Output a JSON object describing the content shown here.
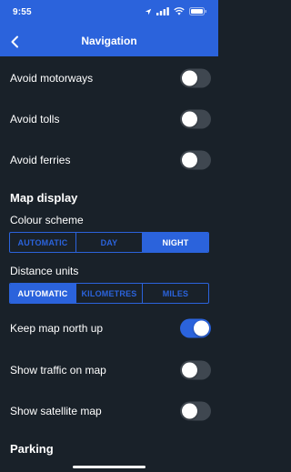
{
  "status_bar": {
    "time": "9:55",
    "location_icon": "location-arrow-icon",
    "signal_icon": "cellular-signal-icon",
    "wifi_icon": "wifi-icon",
    "battery_icon": "battery-icon"
  },
  "nav": {
    "title": "Navigation",
    "back_icon": "chevron-left-icon"
  },
  "route_options": [
    {
      "label": "Avoid motorways",
      "on": false
    },
    {
      "label": "Avoid tolls",
      "on": false
    },
    {
      "label": "Avoid ferries",
      "on": false
    }
  ],
  "map_display": {
    "title": "Map display",
    "colour_scheme": {
      "label": "Colour scheme",
      "options": [
        "AUTOMATIC",
        "DAY",
        "NIGHT"
      ],
      "selected": "NIGHT"
    },
    "distance_units": {
      "label": "Distance units",
      "options": [
        "AUTOMATIC",
        "KILOMETRES",
        "MILES"
      ],
      "selected": "AUTOMATIC"
    },
    "toggles": [
      {
        "label": "Keep map north up",
        "on": true
      },
      {
        "label": "Show traffic on map",
        "on": false
      },
      {
        "label": "Show satellite map",
        "on": false
      }
    ]
  },
  "parking": {
    "title": "Parking"
  },
  "colors": {
    "accent": "#2b63dc",
    "background": "#192129",
    "toggle_off": "#3f4750",
    "text": "#ffffff"
  }
}
